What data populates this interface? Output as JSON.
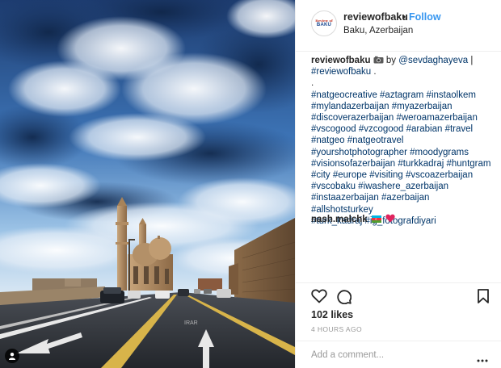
{
  "post": {
    "username": "reviewofbaku",
    "follow_label": "Follow",
    "separator": "•",
    "location": "Baku, Azerbaijan",
    "avatar": {
      "top_text": "Review of",
      "main_text": "BAKU"
    }
  },
  "caption": {
    "username": "reviewofbaku",
    "camera_icon": "camera-emoji",
    "by_text": "by",
    "credit_handle": "@sevdaghayeva",
    "pipe": "|",
    "first_tag": "#reviewofbaku",
    "period": ".",
    "dot_line": ".",
    "hashtags": [
      "#natgeocreative #aztagram #instaolkem",
      "#mylandazerbaijan #myazerbaijan",
      "#discoverazerbaijan #weroamazerbaijan",
      "#vscogood #vzcogood #arabian #travel",
      "#natgeo #natgeotravel",
      "#yourshotphotographer #moodygrams",
      "#visionsofazerbaijan #turkkadraj #huntgram",
      "#city #europe #visiting #vscoazerbaijan",
      "#vscobaku #iwashere_azerbaijan",
      "#instaazerbaijan #azerbaijan #allshotsturkey",
      "#turk_kadraj #ig_fotografdiyari"
    ]
  },
  "comment": {
    "username": "nash.malchk",
    "emojis": [
      "azerbaijan-flag",
      "red-heart"
    ]
  },
  "actions": {
    "like_icon": "heart-icon",
    "comment_icon": "speech-bubble-icon",
    "save_icon": "bookmark-icon"
  },
  "likes_text": "102 likes",
  "timestamp": "4 HOURS AGO",
  "add_comment": {
    "placeholder": "Add a comment...",
    "more_icon": "more-options-icon"
  },
  "photo": {
    "user_tag_icon": "user-tag-icon"
  },
  "colors": {
    "link": "#003569",
    "follow": "#3897f0",
    "muted": "#999999",
    "text": "#262626",
    "border": "#efefef"
  }
}
